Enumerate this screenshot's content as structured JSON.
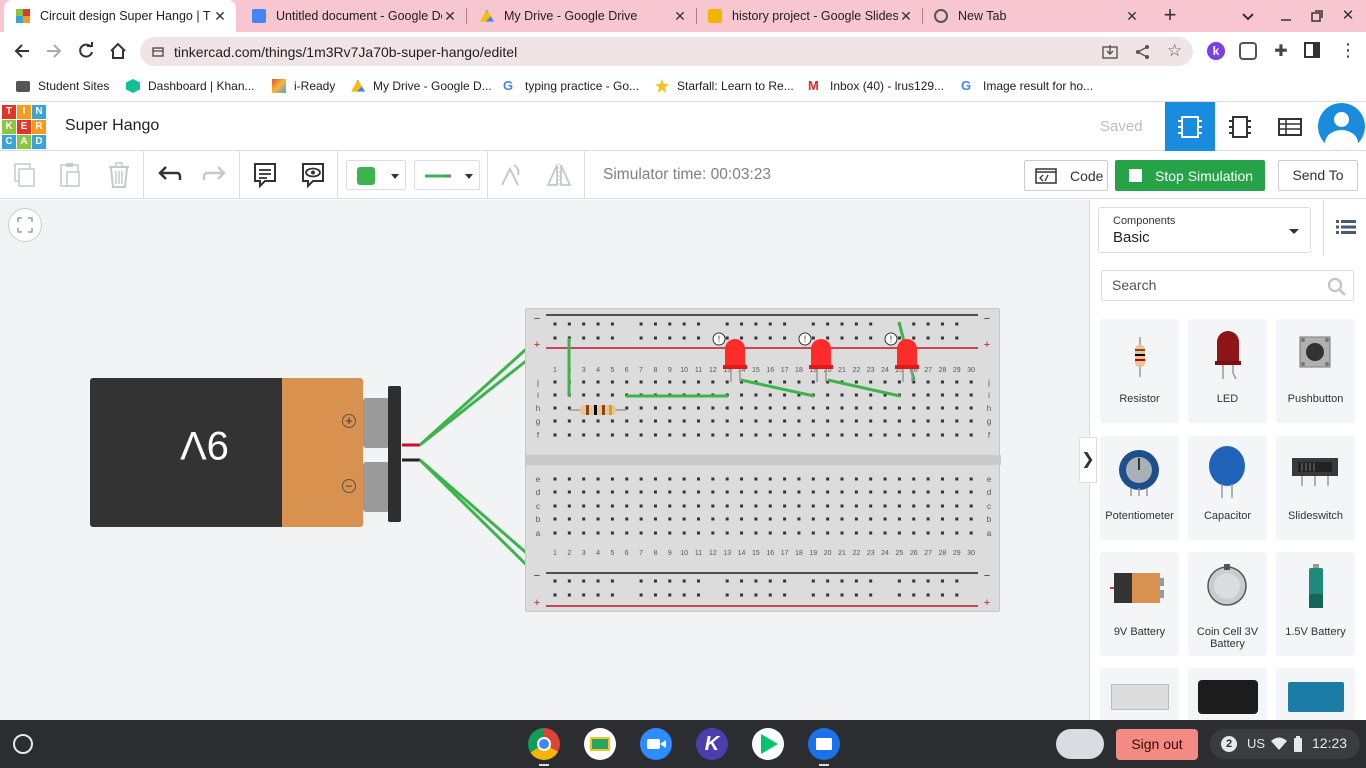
{
  "browser": {
    "tabs": [
      {
        "title": "Circuit design Super Hango | T",
        "active": true
      },
      {
        "title": "Untitled document - Google Do",
        "active": false
      },
      {
        "title": "My Drive - Google Drive",
        "active": false
      },
      {
        "title": "history project - Google Slides",
        "active": false
      },
      {
        "title": "New Tab",
        "active": false
      }
    ],
    "url": "tinkercad.com/things/1m3Rv7Ja70b-super-hango/editel",
    "bookmarks": [
      "Student Sites",
      "Dashboard | Khan...",
      "i-Ready",
      "My Drive - Google D...",
      "typing practice - Go...",
      "Starfall: Learn to Re...",
      "Inbox (40) - lrus129...",
      "Image result for ho..."
    ]
  },
  "app": {
    "logo": [
      "T",
      "I",
      "N",
      "K",
      "E",
      "R",
      "C",
      "A",
      "D"
    ],
    "project_title": "Super Hango",
    "save_status": "Saved"
  },
  "toolbar": {
    "simulator_time": "Simulator time: 00:03:23",
    "code_label": "Code",
    "stop_label": "Stop Simulation",
    "send_label": "Send To",
    "color": "#3cb44b"
  },
  "canvas": {
    "battery_label": "9V",
    "plus": "+",
    "minus": "−"
  },
  "panel": {
    "components_label": "Components",
    "category": "Basic",
    "search_placeholder": "Search",
    "items": [
      "Resistor",
      "LED",
      "Pushbutton",
      "Potentiometer",
      "Capacitor",
      "Slideswitch",
      "9V Battery",
      "Coin Cell 3V Battery",
      "1.5V Battery"
    ]
  },
  "taskbar": {
    "sign_out": "Sign out",
    "badge": "2",
    "locale": "US",
    "clock": "12:23"
  }
}
